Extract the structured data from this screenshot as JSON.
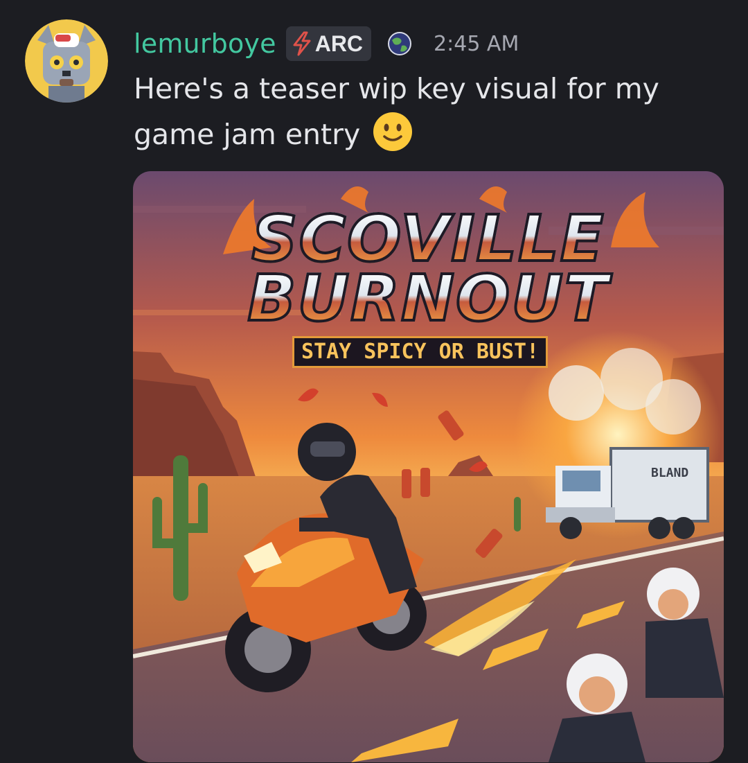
{
  "message": {
    "author": "lemurboye",
    "tag": "ARC",
    "timestamp": "2:45 AM",
    "text": "Here's a teaser wip key visual for my game jam entry",
    "emoji": "slightly-smiling-face"
  },
  "attachment": {
    "title_line1": "SCOVILLE",
    "title_line2": "BURNOUT",
    "tagline": "STAY SPICY OR BUST!",
    "truck_label": "BLAND"
  },
  "colors": {
    "username": "#43c8a0",
    "background": "#1c1d22",
    "tag_bg": "#33353d",
    "timestamp": "#a6a8b1",
    "text": "#e5e6ea"
  },
  "icons": {
    "tag_icon": "lightning-bolt-icon",
    "server_icon": "globe-icon"
  }
}
